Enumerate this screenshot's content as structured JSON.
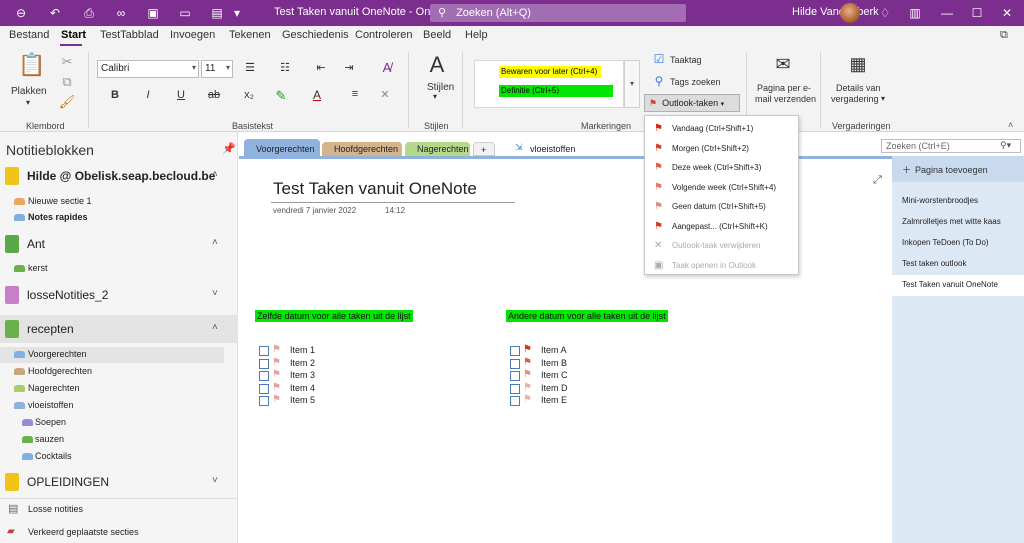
{
  "titlebar": {
    "title": "Test Taken vanuit OneNote  -  OneNote",
    "search_placeholder": "Zoeken (Alt+Q)",
    "user": "Hilde Vandenberk"
  },
  "menu": [
    "Bestand",
    "Start",
    "TestTabblad",
    "Invoegen",
    "Tekenen",
    "Geschiedenis",
    "Controleren",
    "Beeld",
    "Help"
  ],
  "ribbon": {
    "plakken": "Plakken",
    "klembord": "Klembord",
    "font": "Calibri",
    "size": "11",
    "basistekst": "Basistekst",
    "stijlen_btn": "Stijlen",
    "stijlen_grp": "Stijlen",
    "tag1": "Bewaren voor later (Ctrl+4)",
    "tag2": "Definitie (Ctrl+5)",
    "markeringen": "Markeringen",
    "taaktag": "Taaktag",
    "tags_zoeken": "Tags zoeken",
    "outlook_taken": "Outlook-taken",
    "email_l1": "Pagina per e-",
    "email_l2": "mail verzenden",
    "details_l1": "Details van",
    "details_l2": "vergadering",
    "vergaderingen": "Vergaderingen",
    "colors": {
      "tag1": "#ffff00",
      "tag2": "#00e600",
      "accent": "#7b2e8e"
    }
  },
  "nav": {
    "title": "Notitieblokken",
    "notebooks": [
      {
        "name": "Hilde @ Obelisk.seap.becloud.be",
        "color": "#f0c419"
      },
      {
        "name": "Ant",
        "color": "#5aa84a"
      },
      {
        "name": "losseNotities_2",
        "color": "#c680c9"
      },
      {
        "name": "recepten",
        "color": "#6ab04c"
      },
      {
        "name": "OPLEIDINGEN",
        "color": "#f0c419"
      }
    ],
    "sections": {
      "s1": "Nieuwe sectie 1",
      "s2": "Notes rapides",
      "s3": "kerst",
      "s4": "Voorgerechten",
      "s5": "Hoofdgerechten",
      "s6": "Nagerechten",
      "s7": "vloeistoffen",
      "s8": "Soepen",
      "s9": "sauzen",
      "s10": "Cocktails"
    },
    "losse": "Losse notities",
    "verkeerd": "Verkeerd geplaatste secties"
  },
  "tabs": {
    "t1": "Voorgerechten",
    "t2": "Hoofdgerechten",
    "t3": "Nagerechten",
    "t4": "+",
    "t5": "vloeistoffen",
    "search": "Zoeken (Ctrl+E)"
  },
  "page": {
    "title": "Test Taken vanuit OneNote",
    "date": "vendredi 7 janvier 2022",
    "time": "14:12",
    "heading_left": "Zelfde datum voor alle taken uit de lijst",
    "heading_right": "Andere datum voor alle taken uit de lijst",
    "items_left": [
      "Item 1",
      "Item 2",
      "Item 3",
      "Item 4",
      "Item 5"
    ],
    "items_right": [
      "Item A",
      "Item B",
      "Item C",
      "Item D",
      "Item E"
    ]
  },
  "pages": {
    "add": "Pagina toevoegen",
    "p1": "Mini-worstenbroodjes",
    "p2": "Zalmrolletjes met witte kaas",
    "p3": "Inkopen TeDoen (To Do)",
    "p4": "Test taken outlook",
    "p5": "Test Taken vanuit OneNote"
  },
  "dropdown": [
    "Vandaag  (Ctrl+Shift+1)",
    "Morgen  (Ctrl+Shift+2)",
    "Deze week  (Ctrl+Shift+3)",
    "Volgende week  (Ctrl+Shift+4)",
    "Geen datum  (Ctrl+Shift+5)",
    "Aangepast...  (Ctrl+Shift+K)",
    "Outlook-taak verwijderen",
    "Taak openen in Outlook"
  ]
}
